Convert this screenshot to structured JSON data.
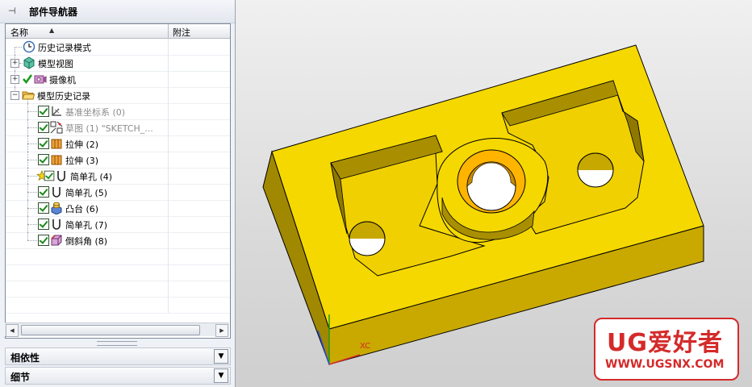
{
  "navigator": {
    "title": "部件导航器",
    "pin_icon": "pin-icon",
    "columns": {
      "name": "名称",
      "note": "附注"
    },
    "rows": [
      {
        "label": "历史记录模式",
        "icon": "clock-icon",
        "grey": false
      },
      {
        "label": "模型视图",
        "icon": "model-view-icon",
        "grey": false
      },
      {
        "label": "摄像机",
        "icon": "camera-icon",
        "grey": false
      },
      {
        "label": "模型历史记录",
        "icon": "folder-icon",
        "grey": false
      },
      {
        "label": "基准坐标系 (0)",
        "icon": "datum-csys-icon",
        "grey": true
      },
      {
        "label": "草图 (1) \"SKETCH_...",
        "icon": "sketch-icon",
        "grey": true
      },
      {
        "label": "拉伸 (2)",
        "icon": "extrude-icon",
        "grey": false
      },
      {
        "label": "拉伸 (3)",
        "icon": "extrude-icon",
        "grey": false
      },
      {
        "label": "简单孔 (4)",
        "icon": "hole-icon",
        "grey": false
      },
      {
        "label": "简单孔 (5)",
        "icon": "hole-icon",
        "grey": false
      },
      {
        "label": "凸台 (6)",
        "icon": "boss-icon",
        "grey": false
      },
      {
        "label": "简单孔 (7)",
        "icon": "hole-icon",
        "grey": false
      },
      {
        "label": "倒斜角 (8)",
        "icon": "chamfer-icon",
        "grey": false
      }
    ],
    "sections": [
      {
        "label": "相依性"
      },
      {
        "label": "细节"
      }
    ]
  },
  "viewport": {
    "triad": {
      "x_label": "XC"
    },
    "part_color": "#f5d800",
    "watermark": {
      "title": "UG爱好者",
      "url": "WWW.UGSNX.COM",
      "color": "#d42a2a"
    }
  }
}
